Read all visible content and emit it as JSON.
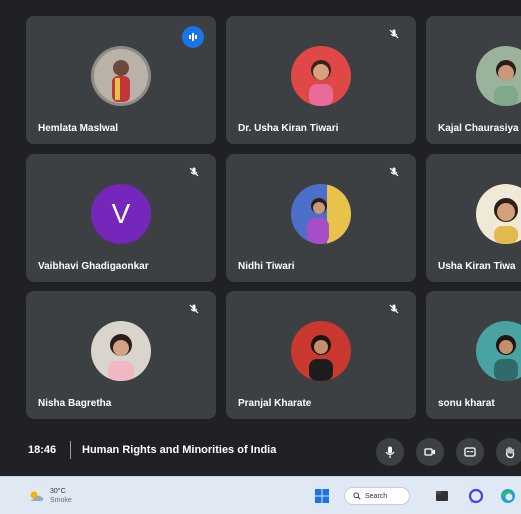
{
  "participants": [
    {
      "name": "Hemlata Maslwal",
      "avatar": "photo",
      "speaking": true
    },
    {
      "name": "Dr. Usha Kiran Tiwari",
      "avatar": "photo",
      "muted": true
    },
    {
      "name": "Kajal Chaurasiya",
      "avatar": "photo"
    },
    {
      "name": "Vaibhavi Ghadigaonkar",
      "avatar": "letter",
      "initial": "V",
      "muted": true
    },
    {
      "name": "Nidhi Tiwari",
      "avatar": "photo",
      "muted": true
    },
    {
      "name": "Usha Kiran Tiwa",
      "avatar": "photo"
    },
    {
      "name": "Nisha Bagretha",
      "avatar": "photo",
      "muted": true
    },
    {
      "name": "Pranjal Kharate",
      "avatar": "photo",
      "muted": true
    },
    {
      "name": "sonu kharat",
      "avatar": "photo"
    }
  ],
  "meeting": {
    "time": "18:46",
    "title": "Human Rights and Minorities of India"
  },
  "controls": [
    "mic-icon",
    "camera-icon",
    "captions-icon",
    "raise-hand-icon"
  ],
  "taskbar": {
    "temperature": "30°C",
    "condition": "Smoke",
    "search_label": "Search"
  },
  "colors": {
    "background": "#202124",
    "tile": "#3c4043",
    "speaking": "#1a73e8",
    "letter_avatar": "#7627bb"
  }
}
